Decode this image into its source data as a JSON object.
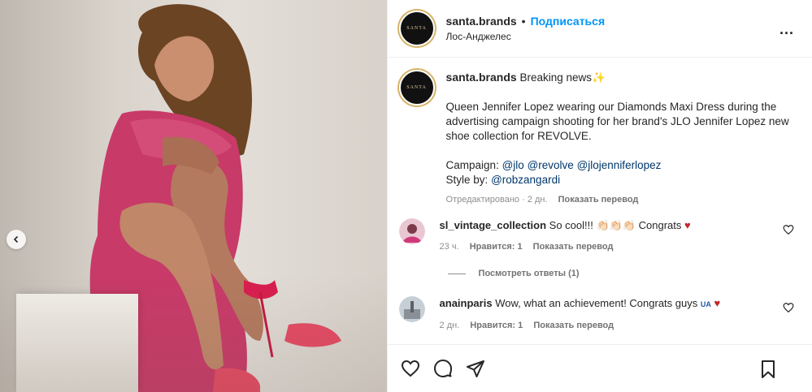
{
  "header": {
    "username": "santa.brands",
    "separator": "•",
    "follow_label": "Подписаться",
    "location": "Лос-Анджелес",
    "more_label": "...",
    "avatar_text": "SANTA"
  },
  "caption": {
    "username": "santa.brands",
    "headline": "Breaking news",
    "headline_emoji": "✨",
    "body": "Queen Jennifer Lopez wearing our Diamonds Maxi Dress during the advertising campaign shooting for her brand's JLO Jennifer Lopez new shoe collection for REVOLVE.",
    "campaign_label": "Campaign:",
    "campaign_tags": [
      "@jlo",
      "@revolve",
      "@jlojenniferlopez"
    ],
    "style_label": "Style by:",
    "style_tag": "@robzangardi",
    "edited": "Отредактировано · 2 дн.",
    "translate": "Показать перевод"
  },
  "comments": [
    {
      "username": "sl_vintage_collection",
      "text": "So cool!!! 👏🏻👏🏻👏🏻 Congrats",
      "emoji_heart": "♥",
      "time": "23 ч.",
      "likes": "Нравится: 1",
      "translate": "Показать перевод",
      "replies": "Посмотреть ответы (1)"
    },
    {
      "username": "anainparis",
      "text": "Wow, what an achievement! Congrats guys",
      "flag": "UA",
      "emoji_heart": "♥",
      "time": "2 дн.",
      "likes": "Нравится: 1",
      "translate": "Показать перевод"
    }
  ],
  "colors": {
    "link": "#0095f6",
    "mention": "#00376b",
    "heart": "#c0272d"
  }
}
